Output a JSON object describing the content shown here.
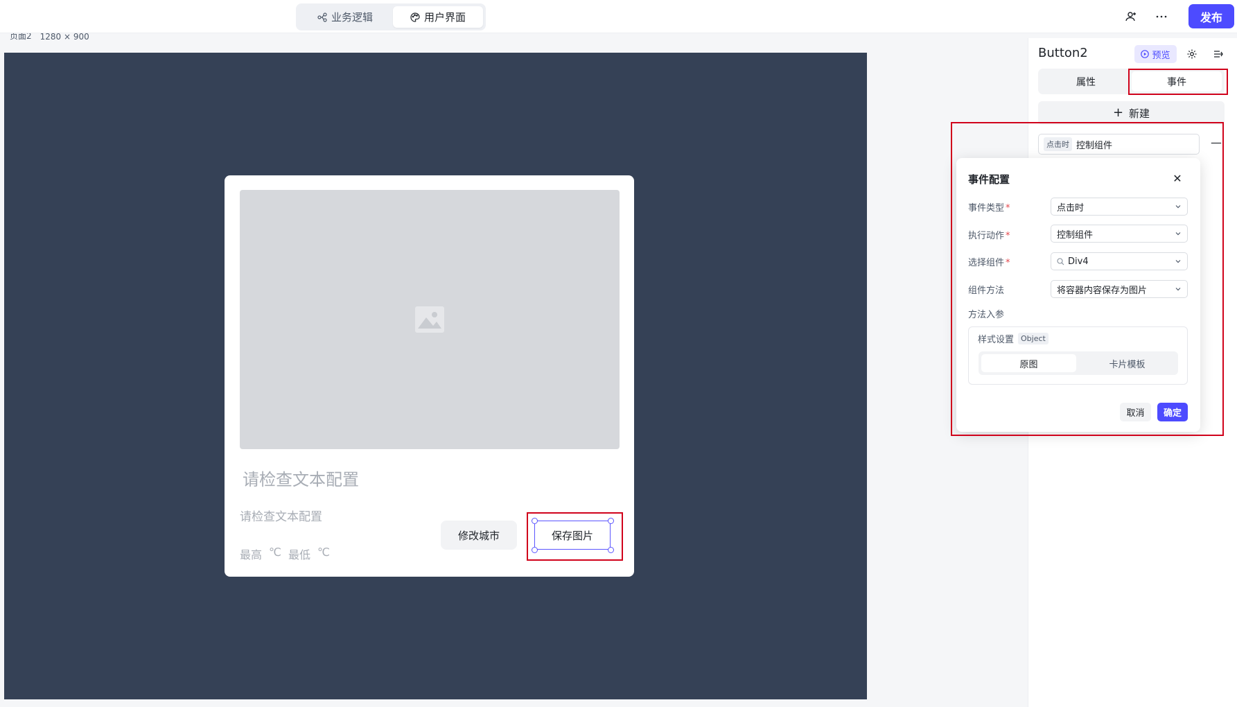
{
  "topbar": {
    "tabs": [
      {
        "label": "业务逻辑",
        "icon": "flow-icon",
        "active": false
      },
      {
        "label": "用户界面",
        "icon": "palette-icon",
        "active": true
      }
    ],
    "publish_label": "发布",
    "icons": [
      "add-user-icon",
      "more-icon"
    ]
  },
  "page_label": {
    "name": "页面2",
    "size": "1280 × 900"
  },
  "card": {
    "title": "请检查文本配置",
    "subtitle": "请检查文本配置",
    "high_label": "最高",
    "high_unit": "℃",
    "low_label": "最低",
    "low_unit": "℃",
    "city_button": "修改城市",
    "save_button": "保存图片"
  },
  "panel": {
    "component_name": "Button2",
    "preview_label": "预览",
    "tabs": [
      {
        "label": "属性",
        "active": false
      },
      {
        "label": "事件",
        "active": true
      }
    ],
    "new_label": "新建",
    "event_tag": "点击时",
    "event_action": "控制组件"
  },
  "popover": {
    "title": "事件配置",
    "fields": [
      {
        "label": "事件类型",
        "required": true,
        "value": "点击时"
      },
      {
        "label": "执行动作",
        "required": true,
        "value": "控制组件"
      },
      {
        "label": "选择组件",
        "required": true,
        "value": "Div4"
      },
      {
        "label": "组件方法",
        "required": false,
        "value": "将容器内容保存为图片"
      }
    ],
    "params_label": "方法入参",
    "style_label": "样式设置",
    "style_type": "Object",
    "segments": [
      {
        "label": "原图",
        "active": true
      },
      {
        "label": "卡片模板",
        "active": false
      }
    ],
    "cancel_label": "取消",
    "ok_label": "确定",
    "required_mark": "*"
  },
  "colors": {
    "accent": "#4d4bff",
    "canvas_bg": "#354156",
    "highlight": "#d0021b"
  }
}
